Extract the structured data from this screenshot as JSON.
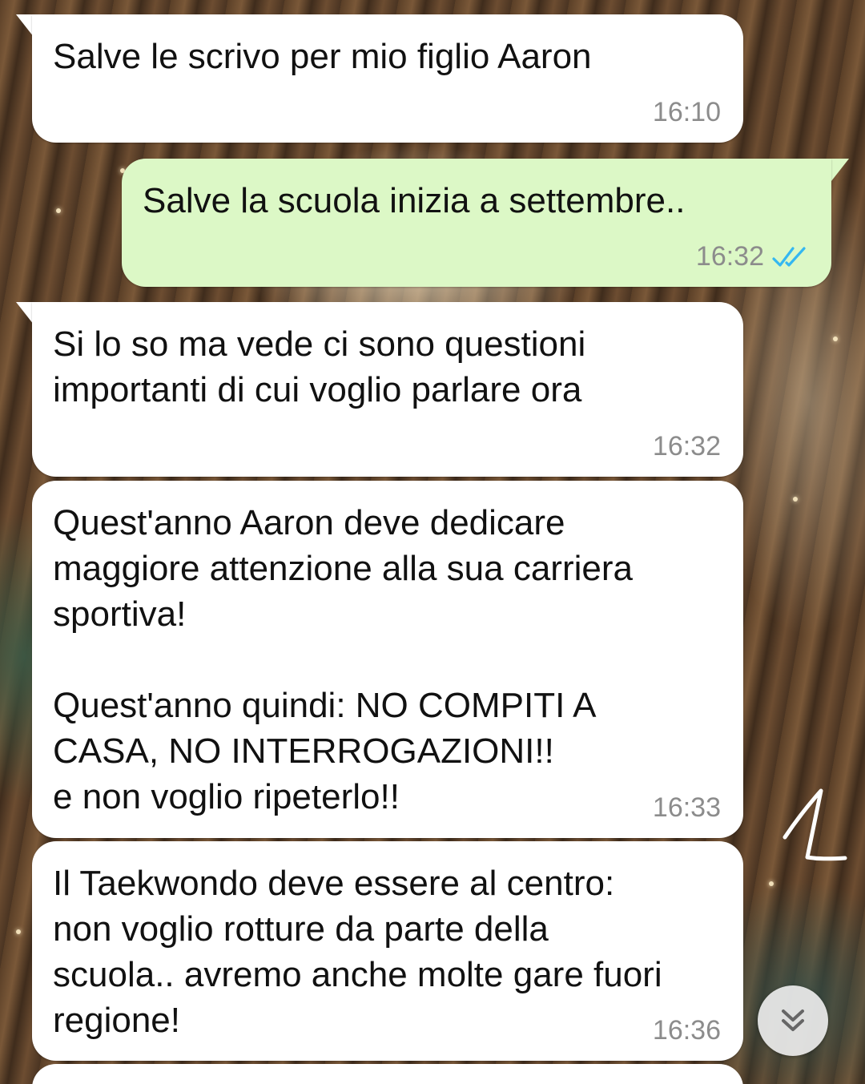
{
  "messages": [
    {
      "direction": "incoming",
      "text": "Salve le scrivo per mio figlio Aaron",
      "time": "16:10"
    },
    {
      "direction": "outgoing",
      "text": "Salve la scuola inizia a settembre..",
      "time": "16:32",
      "status": "read"
    },
    {
      "direction": "incoming",
      "text": "Si lo so ma vede ci sono questioni\nimportanti di cui voglio parlare ora",
      "time": "16:32"
    },
    {
      "direction": "incoming",
      "text": "Quest'anno Aaron deve dedicare\nmaggiore attenzione alla sua carriera\nsportiva!\n\nQuest'anno quindi: NO COMPITI A\nCASA, NO INTERROGAZIONI!!\ne non voglio ripeterlo!!",
      "time": "16:33"
    },
    {
      "direction": "incoming",
      "text": "Il Taekwondo deve essere al centro:\nnon voglio rotture da parte della\nscuola.. avremo anche molte gare fuori\nregione!",
      "time": "16:36"
    }
  ],
  "colors": {
    "incoming_bubble": "#ffffff",
    "outgoing_bubble": "#dcf8c6",
    "read_ticks": "#34b7f1",
    "timestamp": "#8c8c8c"
  },
  "icons": {
    "read_status": "double-check-icon",
    "scroll_down": "double-chevron-down-icon"
  }
}
